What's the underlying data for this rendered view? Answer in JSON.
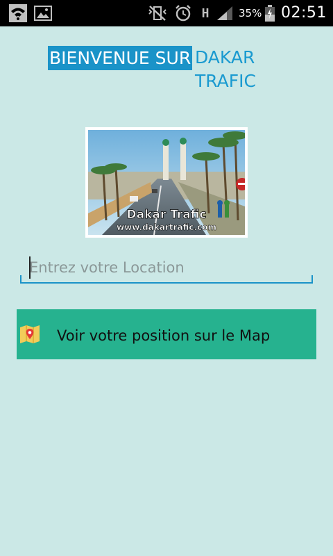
{
  "status_bar": {
    "icons": [
      "wifi-icon",
      "gallery-icon",
      "no-vibrate-icon",
      "alarm-icon",
      "hspa-icon",
      "signal-icon",
      "battery-icon"
    ],
    "network_type": "H",
    "battery_percent": "35%",
    "time": "02:51"
  },
  "header": {
    "welcome_text": "BIENVENUE SUR",
    "app_name": "DAKAR TRAFIC",
    "highlight_color": "#1a93c8",
    "app_name_color": "#1a9ad0"
  },
  "logo": {
    "title": "Dakar Trafic",
    "url": "www.dakartrafic.com"
  },
  "location_input": {
    "placeholder": "Entrez votre Location",
    "value": ""
  },
  "map_button": {
    "label": "Voir votre position sur le Map",
    "icon": "map-pin-icon",
    "color": "#26b28f"
  },
  "background_color": "#cbe8e6"
}
